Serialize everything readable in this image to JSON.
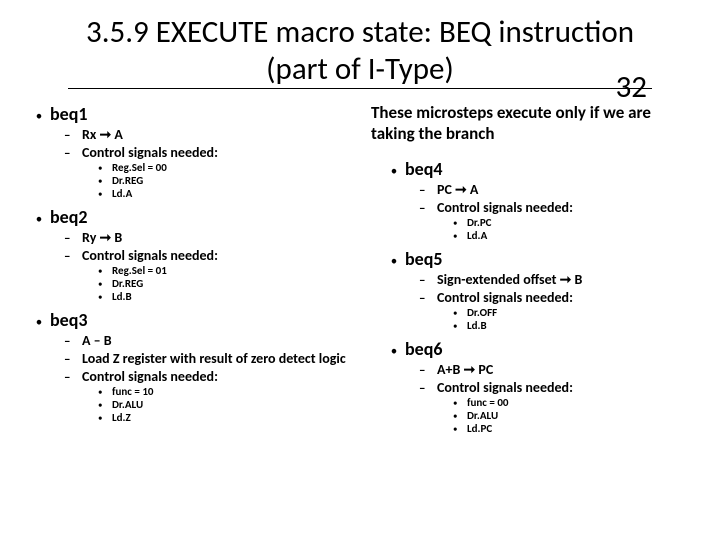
{
  "title": "3.5.9 EXECUTE macro state: BEQ instruction (part of I-Type)",
  "slide_number": "32",
  "note": "These microsteps execute only if we are taking the branch",
  "left": [
    {
      "label": "beq1",
      "subs": [
        {
          "text": "Rx ➞ A"
        },
        {
          "text": "Control signals needed:",
          "signals": [
            "Reg.Sel = 00",
            "Dr.REG",
            "Ld.A"
          ]
        }
      ]
    },
    {
      "label": "beq2",
      "subs": [
        {
          "text": "Ry ➞ B"
        },
        {
          "text": "Control signals needed:",
          "signals": [
            "Reg.Sel = 01",
            "Dr.REG",
            "Ld.B"
          ]
        }
      ]
    },
    {
      "label": "beq3",
      "subs": [
        {
          "text": "A – B"
        },
        {
          "text": "Load Z register with result of zero detect logic"
        },
        {
          "text": "Control signals needed:",
          "signals": [
            "func = 10",
            "Dr.ALU",
            "Ld.Z"
          ]
        }
      ]
    }
  ],
  "right": [
    {
      "label": "beq4",
      "subs": [
        {
          "text": "PC ➞ A"
        },
        {
          "text": "Control signals needed:",
          "signals": [
            "Dr.PC",
            "Ld.A"
          ]
        }
      ]
    },
    {
      "label": "beq5",
      "subs": [
        {
          "text": "Sign-extended offset ➞ B"
        },
        {
          "text": "Control signals needed:",
          "signals": [
            "Dr.OFF",
            "Ld.B"
          ]
        }
      ]
    },
    {
      "label": "beq6",
      "subs": [
        {
          "text": "A+B ➞ PC"
        },
        {
          "text": "Control signals needed:",
          "signals": [
            "func = 00",
            "Dr.ALU",
            "Ld.PC"
          ]
        }
      ]
    }
  ]
}
